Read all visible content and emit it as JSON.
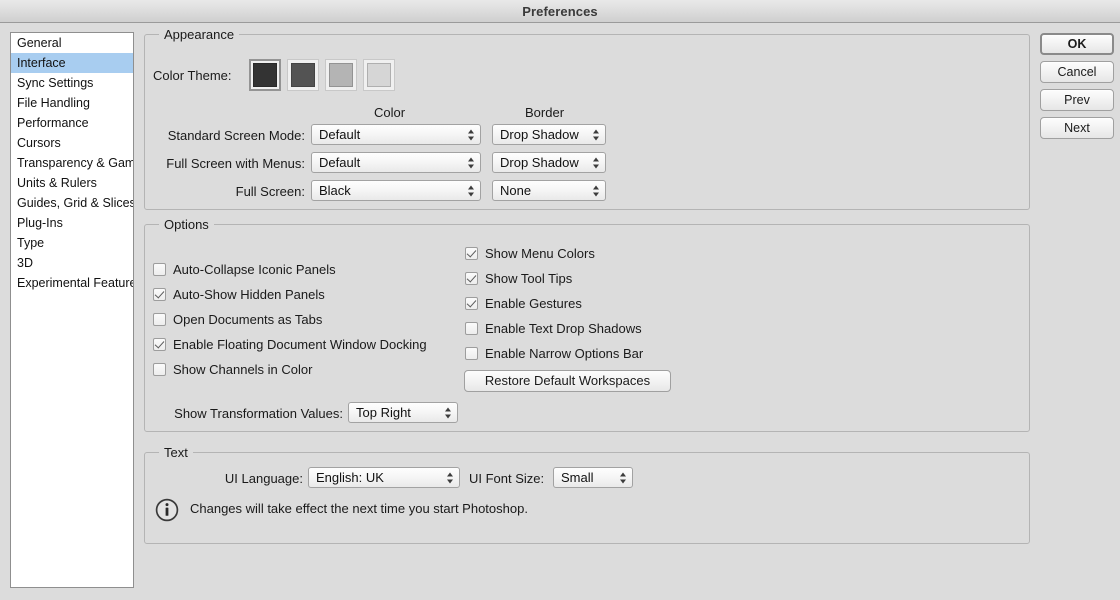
{
  "window": {
    "title": "Preferences"
  },
  "sidebar": {
    "items": [
      {
        "label": "General",
        "selected": false
      },
      {
        "label": "Interface",
        "selected": true
      },
      {
        "label": "Sync Settings",
        "selected": false
      },
      {
        "label": "File Handling",
        "selected": false
      },
      {
        "label": "Performance",
        "selected": false
      },
      {
        "label": "Cursors",
        "selected": false
      },
      {
        "label": "Transparency & Gamut",
        "selected": false
      },
      {
        "label": "Units & Rulers",
        "selected": false
      },
      {
        "label": "Guides, Grid & Slices",
        "selected": false
      },
      {
        "label": "Plug-Ins",
        "selected": false
      },
      {
        "label": "Type",
        "selected": false
      },
      {
        "label": "3D",
        "selected": false
      },
      {
        "label": "Experimental Features",
        "selected": false
      }
    ]
  },
  "buttons": {
    "ok": "OK",
    "cancel": "Cancel",
    "prev": "Prev",
    "next": "Next"
  },
  "appearance": {
    "group_label": "Appearance",
    "color_theme_label": "Color Theme:",
    "themes": [
      {
        "name": "theme-darkest",
        "color": "#333333",
        "selected": true
      },
      {
        "name": "theme-dark",
        "color": "#535353",
        "selected": false
      },
      {
        "name": "theme-medium",
        "color": "#b4b4b4",
        "selected": false
      },
      {
        "name": "theme-light",
        "color": "#d6d6d6",
        "selected": false
      }
    ],
    "col_color": "Color",
    "col_border": "Border",
    "rows": [
      {
        "label": "Standard Screen Mode:",
        "color": "Default",
        "border": "Drop Shadow"
      },
      {
        "label": "Full Screen with Menus:",
        "color": "Default",
        "border": "Drop Shadow"
      },
      {
        "label": "Full Screen:",
        "color": "Black",
        "border": "None"
      }
    ]
  },
  "options": {
    "group_label": "Options",
    "left_checks": [
      {
        "label": "Auto-Collapse Iconic Panels",
        "checked": false
      },
      {
        "label": "Auto-Show Hidden Panels",
        "checked": true
      },
      {
        "label": "Open Documents as Tabs",
        "checked": false
      },
      {
        "label": "Enable Floating Document Window Docking",
        "checked": true
      },
      {
        "label": "Show Channels in Color",
        "checked": false
      }
    ],
    "right_checks": [
      {
        "label": "Show Menu Colors",
        "checked": true
      },
      {
        "label": "Show Tool Tips",
        "checked": true
      },
      {
        "label": "Enable Gestures",
        "checked": true
      },
      {
        "label": "Enable Text Drop Shadows",
        "checked": false
      },
      {
        "label": "Enable Narrow Options Bar",
        "checked": false
      }
    ],
    "restore_button": "Restore Default Workspaces",
    "transform_label": "Show Transformation Values:",
    "transform_value": "Top Right"
  },
  "text_section": {
    "group_label": "Text",
    "ui_language_label": "UI Language:",
    "ui_language_value": "English: UK",
    "ui_font_size_label": "UI Font Size:",
    "ui_font_size_value": "Small",
    "note_icon": "info-icon",
    "note": "Changes will take effect the next time you start Photoshop."
  },
  "colors": {
    "selection": "#a8cdf0",
    "window_bg": "#dcdcdc"
  }
}
